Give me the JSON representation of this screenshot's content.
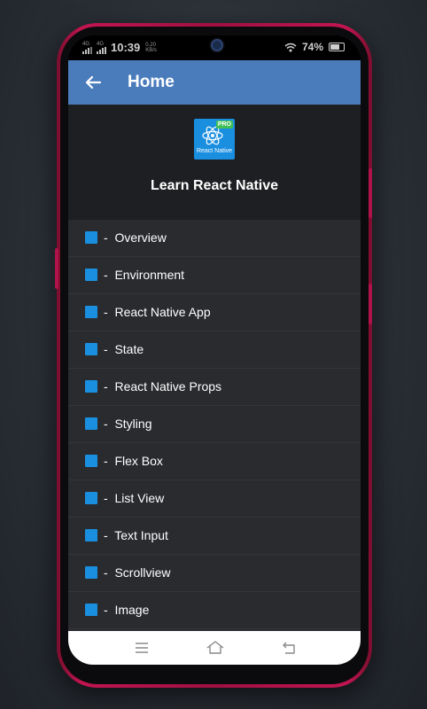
{
  "status_bar": {
    "network_1": "4G",
    "network_2": "4G",
    "time": "10:39",
    "speed_value": "0.20",
    "speed_unit": "KB/s",
    "battery": "74%"
  },
  "app_bar": {
    "title": "Home",
    "back_icon": "arrow-left-icon"
  },
  "header": {
    "logo_badge": "PRO",
    "logo_text": "React Native",
    "title": "Learn React Native"
  },
  "list": {
    "prefix": "-",
    "items": [
      {
        "label": "Overview"
      },
      {
        "label": "Environment"
      },
      {
        "label": "React Native App"
      },
      {
        "label": "State"
      },
      {
        "label": "React Native Props"
      },
      {
        "label": "Styling"
      },
      {
        "label": "Flex Box"
      },
      {
        "label": "List View"
      },
      {
        "label": "Text Input"
      },
      {
        "label": "Scrollview"
      },
      {
        "label": "Image"
      }
    ]
  },
  "nav_bar": {
    "menu_icon": "menu-icon",
    "home_icon": "home-icon",
    "back_icon": "back-icon"
  },
  "colors": {
    "app_bar": "#4a7cbc",
    "list_bg": "#2a2b2f",
    "header_bg": "#1e1f22",
    "icon_blue": "#1a8fe0",
    "phone_frame": "#c21550"
  }
}
